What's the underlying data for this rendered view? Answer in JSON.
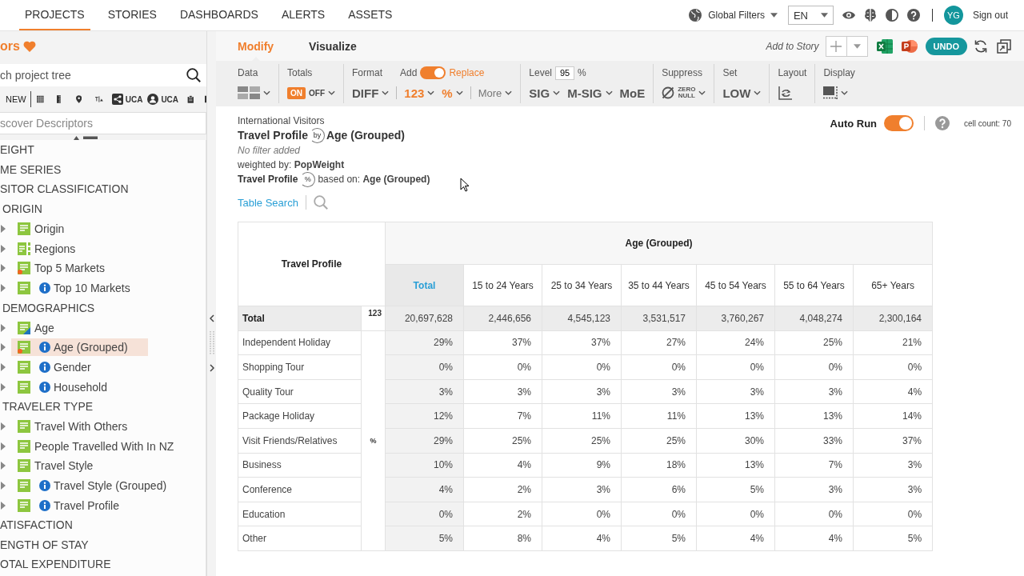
{
  "top_nav": {
    "tabs": [
      {
        "label": "PROJECTS",
        "selected": true
      },
      {
        "label": "STORIES",
        "selected": false
      },
      {
        "label": "DASHBOARDS",
        "selected": false
      },
      {
        "label": "ALERTS",
        "selected": false
      },
      {
        "label": "ASSETS",
        "selected": false
      }
    ],
    "global_filters": "Global Filters",
    "language": "EN",
    "avatar": "YG",
    "sign_out": "Sign out"
  },
  "sidebar": {
    "title": "ors",
    "search": {
      "placeholder": "ch project tree"
    },
    "toolbar": [
      {
        "kind": "new",
        "label": "NEW"
      },
      {
        "kind": "grid"
      },
      {
        "kind": "ruler"
      },
      {
        "kind": "pin"
      },
      {
        "kind": "text-size"
      },
      {
        "kind": "share",
        "label": "UCA"
      },
      {
        "kind": "user",
        "label": "UCA"
      },
      {
        "kind": "clipboard"
      },
      {
        "kind": "bar"
      }
    ],
    "descriptor_search": {
      "placeholder": "scover Descriptors"
    },
    "tree": [
      {
        "label": "EIGHT"
      },
      {
        "label": "ME SERIES"
      },
      {
        "label": "SITOR CLASSIFICATION"
      },
      {
        "label": "ORIGIN",
        "children": [
          {
            "label": "Origin",
            "kind": "list",
            "info": false,
            "selected": false
          },
          {
            "label": "Regions",
            "kind": "hierarchy",
            "info": false,
            "selected": false
          },
          {
            "label": "Top 5 Markets",
            "kind": "flagged",
            "info": false,
            "selected": false
          },
          {
            "label": "Top 10 Markets",
            "kind": "list",
            "info": true,
            "selected": false
          }
        ]
      },
      {
        "label": "DEMOGRAPHICS",
        "children": [
          {
            "label": "Age",
            "kind": "banded",
            "info": false,
            "selected": false
          },
          {
            "label": "Age (Grouped)",
            "kind": "flagged",
            "info": true,
            "selected": true
          },
          {
            "label": "Gender",
            "kind": "list",
            "info": true,
            "selected": false
          },
          {
            "label": "Household",
            "kind": "list",
            "info": true,
            "selected": false
          }
        ]
      },
      {
        "label": "TRAVELER TYPE",
        "children": [
          {
            "label": "Travel With Others",
            "kind": "list",
            "info": false,
            "selected": false
          },
          {
            "label": "People Travelled With In NZ",
            "kind": "list",
            "info": false,
            "selected": false
          },
          {
            "label": "Travel Style",
            "kind": "list",
            "info": false,
            "selected": false
          },
          {
            "label": "Travel Style (Grouped)",
            "kind": "list",
            "info": true,
            "selected": false
          },
          {
            "label": "Travel Profile",
            "kind": "list",
            "info": true,
            "selected": false
          }
        ]
      },
      {
        "label": "ATISFACTION"
      },
      {
        "label": "ENGTH OF STAY"
      },
      {
        "label": "OTAL EXPENDITURE"
      }
    ]
  },
  "tabs": [
    {
      "label": "Modify",
      "selected": true
    },
    {
      "label": "Visualize",
      "selected": false
    }
  ],
  "story": "Add to Story",
  "undo": "UNDO",
  "toolbar": {
    "data": {
      "label": "Data"
    },
    "totals": {
      "label": "Totals",
      "on_label": "ON",
      "off_label": "OFF",
      "on": true
    },
    "format": {
      "label": "Format",
      "add_label": "Add",
      "replace_label": "Replace",
      "replace": true,
      "options": [
        {
          "label": "DIFF",
          "selected": false
        },
        {
          "label": "123",
          "selected": true
        },
        {
          "label": "%",
          "selected": true
        }
      ],
      "more": "More"
    },
    "level": {
      "label": "Level",
      "value": "95",
      "unit": "%",
      "options": [
        {
          "label": "SIG",
          "dropdown": true
        },
        {
          "label": "M-SIG",
          "dropdown": true
        },
        {
          "label": "MoE",
          "dropdown": false
        }
      ]
    },
    "suppress": {
      "label": "Suppress",
      "lines": [
        "ZERO",
        "NULL"
      ]
    },
    "set": {
      "label": "Set",
      "value": "LOW"
    },
    "layout": {
      "label": "Layout"
    },
    "display": {
      "label": "Display"
    }
  },
  "report": {
    "project": "International Visitors",
    "row_variable": "Travel Profile",
    "connector": "by",
    "column_variable": "Age (Grouped)",
    "filter": "No filter added",
    "weight": "weighted by: **PopWeight**",
    "base_variable": "Travel Profile",
    "base_symbol": "%",
    "base": "based on: **Age (Grouped)**",
    "table_search": "Table Search",
    "auto_run": {
      "label": "Auto Run",
      "on": true
    },
    "cell_count": "cell count: 70"
  },
  "table": {
    "row_header": "Travel Profile",
    "column_header": "Age (Grouped)",
    "columns": [
      {
        "label": "Total",
        "kind": "total"
      },
      {
        "label": "15 to 24 Years",
        "kind": "category"
      },
      {
        "label": "25 to 34 Years",
        "kind": "category"
      },
      {
        "label": "35 to 44 Years",
        "kind": "category"
      },
      {
        "label": "45 to 54 Years",
        "kind": "category"
      },
      {
        "label": "55 to 64 Years",
        "kind": "category"
      },
      {
        "label": "65+ Years",
        "kind": "category"
      }
    ],
    "sections": [
      {
        "format": "123",
        "rows": [
          {
            "label": "Total",
            "kind": "total",
            "cells": [
              "20,697,628",
              "2,446,656",
              "4,545,123",
              "3,531,517",
              "3,760,267",
              "4,048,274",
              "2,300,164"
            ]
          }
        ]
      },
      {
        "format": "%",
        "rows": [
          {
            "label": "Independent Holiday",
            "kind": "category",
            "cells": [
              "29%",
              "37%",
              "37%",
              "27%",
              "24%",
              "25%",
              "21%"
            ]
          },
          {
            "label": "Shopping Tour",
            "kind": "category",
            "cells": [
              "0%",
              "0%",
              "0%",
              "0%",
              "0%",
              "0%",
              "0%"
            ]
          },
          {
            "label": "Quality Tour",
            "kind": "category",
            "cells": [
              "3%",
              "3%",
              "3%",
              "3%",
              "3%",
              "3%",
              "4%"
            ]
          },
          {
            "label": "Package Holiday",
            "kind": "category",
            "cells": [
              "12%",
              "7%",
              "11%",
              "11%",
              "13%",
              "13%",
              "14%"
            ]
          },
          {
            "label": "Visit Friends/Relatives",
            "kind": "category",
            "cells": [
              "29%",
              "25%",
              "25%",
              "25%",
              "30%",
              "33%",
              "37%"
            ]
          },
          {
            "label": "Business",
            "kind": "category",
            "cells": [
              "10%",
              "4%",
              "9%",
              "18%",
              "13%",
              "7%",
              "3%"
            ]
          },
          {
            "label": "Conference",
            "kind": "category",
            "cells": [
              "4%",
              "2%",
              "3%",
              "6%",
              "5%",
              "3%",
              "3%"
            ]
          },
          {
            "label": "Education",
            "kind": "category",
            "cells": [
              "0%",
              "2%",
              "0%",
              "0%",
              "0%",
              "0%",
              "0%"
            ]
          },
          {
            "label": "Other",
            "kind": "category",
            "cells": [
              "5%",
              "8%",
              "4%",
              "5%",
              "4%",
              "4%",
              "5%"
            ]
          }
        ]
      }
    ]
  }
}
